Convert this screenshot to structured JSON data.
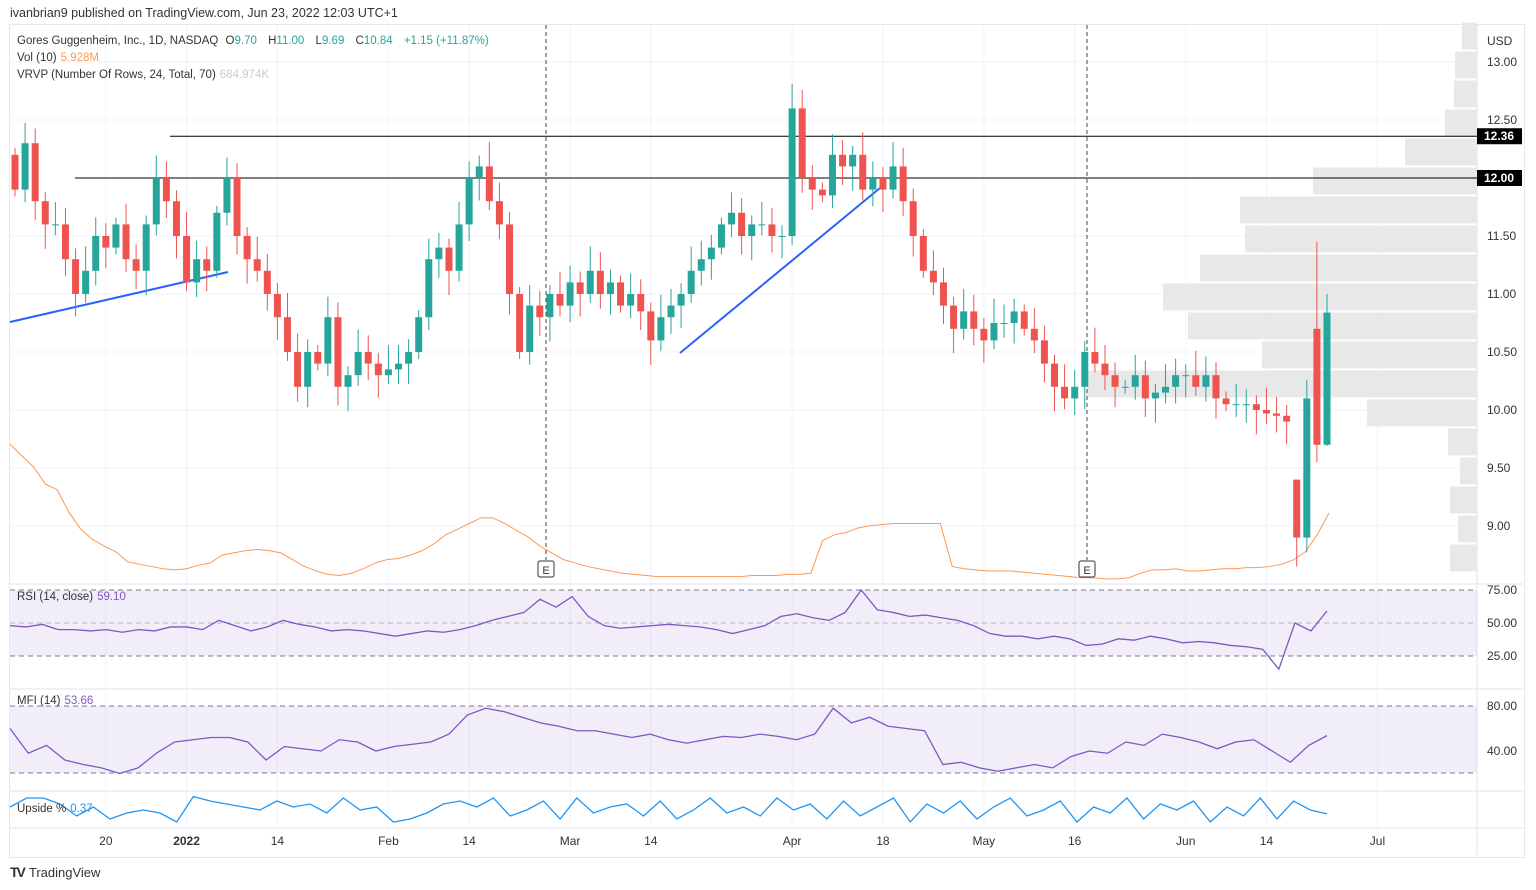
{
  "header": {
    "published": "ivanbrian9 published on TradingView.com, Jun 23, 2022 12:03 UTC+1"
  },
  "legend": {
    "symbol": "Gores Guggenheim, Inc., 1D, NASDAQ",
    "o_label": "O",
    "o": "9.70",
    "h_label": "H",
    "h": "11.00",
    "l_label": "L",
    "l": "9.69",
    "c_label": "C",
    "c": "10.84",
    "change": "+1.15 (+11.87%)",
    "vol_label": "Vol (10)",
    "vol": "5.928M",
    "vrvp_label": "VRVP (Number Of Rows, 24, Total, 70)",
    "vrvp": "684.974K",
    "rsi_label": "RSI (14, close)",
    "rsi": "59.10",
    "mfi_label": "MFI (14)",
    "mfi": "53.66",
    "upside_label": "Upside %",
    "upside": "0.37"
  },
  "footer": {
    "brand": "TradingView"
  },
  "colors": {
    "up": "#26a69a",
    "down": "#ef5350",
    "volume": "#ff9850",
    "osc": "#7e57c2",
    "upside": "#2196f3",
    "trend": "#2962ff"
  },
  "chart_data": {
    "type": "candlestick",
    "currency": "USD",
    "price_ticks": [
      "13.00",
      "12.50",
      "11.50",
      "11.00",
      "10.50",
      "10.00",
      "9.50",
      "9.00"
    ],
    "price_ylim": [
      8.55,
      13.35
    ],
    "level_labels": [
      "12.36",
      "12.00"
    ],
    "levels": [
      12.36,
      12.0
    ],
    "date_ticks": [
      {
        "label": "20",
        "bar": 9
      },
      {
        "label": "2022",
        "bar": 17
      },
      {
        "label": "14",
        "bar": 26
      },
      {
        "label": "Feb",
        "bar": 37
      },
      {
        "label": "14",
        "bar": 45
      },
      {
        "label": "Mar",
        "bar": 55
      },
      {
        "label": "14",
        "bar": 63
      },
      {
        "label": "Apr",
        "bar": 77
      },
      {
        "label": "18",
        "bar": 86
      },
      {
        "label": "May",
        "bar": 96
      },
      {
        "label": "16",
        "bar": 105
      },
      {
        "label": "Jun",
        "bar": 116
      },
      {
        "label": "14",
        "bar": 124
      },
      {
        "label": "Jul",
        "bar": 135
      }
    ],
    "earnings_bars": [
      53,
      105
    ],
    "earnings_label": "E",
    "closes": [
      11.9,
      12.3,
      11.8,
      11.6,
      11.6,
      11.3,
      11.0,
      11.2,
      11.5,
      11.4,
      11.6,
      11.3,
      11.2,
      11.6,
      12.0,
      11.8,
      11.5,
      11.1,
      11.3,
      11.2,
      11.7,
      12.0,
      11.5,
      11.3,
      11.2,
      11.0,
      10.8,
      10.5,
      10.2,
      10.5,
      10.4,
      10.8,
      10.2,
      10.3,
      10.5,
      10.4,
      10.3,
      10.35,
      10.4,
      10.5,
      10.8,
      11.3,
      11.4,
      11.2,
      11.6,
      12.0,
      12.1,
      11.8,
      11.6,
      11.0,
      10.5,
      10.9,
      10.8,
      11.0,
      10.9,
      11.1,
      11.0,
      11.2,
      11.0,
      11.1,
      10.9,
      11.0,
      10.85,
      10.6,
      10.8,
      10.9,
      11.0,
      11.2,
      11.3,
      11.4,
      11.6,
      11.7,
      11.5,
      11.6,
      11.6,
      11.5,
      11.5,
      12.6,
      12.0,
      11.9,
      11.85,
      12.2,
      12.1,
      12.2,
      11.9,
      12.0,
      11.9,
      12.1,
      11.8,
      11.5,
      11.2,
      11.1,
      10.9,
      10.7,
      10.85,
      10.7,
      10.6,
      10.75,
      10.75,
      10.85,
      10.7,
      10.6,
      10.4,
      10.2,
      10.1,
      10.2,
      10.5,
      10.4,
      10.3,
      10.2,
      10.2,
      10.3,
      10.1,
      10.15,
      10.2,
      10.3,
      10.3,
      10.2,
      10.3,
      10.1,
      10.05,
      10.05,
      10.05,
      10.0,
      9.97,
      9.95,
      9.9,
      8.9,
      10.1,
      9.7,
      10.84
    ],
    "last_bar": {
      "open": 9.7,
      "high": 11.0,
      "low": 9.69,
      "close": 10.84
    },
    "volume_ma_millions": [
      12,
      11,
      10,
      8.5,
      8,
      6,
      4.5,
      3.6,
      3,
      2.5,
      1.6,
      1.4,
      1.2,
      1.0,
      0.9,
      1.0,
      1.3,
      1.5,
      2.2,
      2.4,
      2.6,
      2.7,
      2.6,
      2.4,
      1.8,
      1.2,
      0.8,
      0.5,
      0.4,
      0.6,
      1.0,
      1.5,
      1.8,
      1.9,
      2.2,
      2.6,
      3.2,
      4.0,
      4.5,
      5.0,
      5.5,
      5.5,
      5.0,
      4.4,
      3.8,
      3.0,
      2.4,
      1.8,
      1.5,
      1.2,
      1.0,
      0.8,
      0.6,
      0.5,
      0.4,
      0.3,
      0.3,
      0.3,
      0.3,
      0.3,
      0.3,
      0.3,
      0.3,
      0.4,
      0.4,
      0.4,
      0.5,
      0.5,
      0.6,
      3.5,
      4.0,
      4.2,
      4.6,
      4.8,
      4.9,
      5.0,
      5.0,
      5.0,
      5.0,
      5.0,
      1.2,
      1.0,
      0.9,
      0.8,
      0.8,
      0.8,
      0.7,
      0.6,
      0.5,
      0.4,
      0.3,
      0.2,
      0.2,
      0.1,
      0.1,
      0.2,
      0.6,
      0.9,
      0.9,
      1.0,
      0.8,
      0.8,
      0.9,
      1.0,
      1.0,
      1.1,
      1.1,
      1.2,
      1.4,
      1.8,
      2.5,
      4.0,
      5.928
    ],
    "vrvp_rows": [
      {
        "price": 13.1,
        "vol": 15
      },
      {
        "price": 12.85,
        "vol": 22
      },
      {
        "price": 12.6,
        "vol": 23
      },
      {
        "price": 12.35,
        "vol": 32
      },
      {
        "price": 12.1,
        "vol": 72
      },
      {
        "price": 11.85,
        "vol": 164
      },
      {
        "price": 11.6,
        "vol": 237
      },
      {
        "price": 11.35,
        "vol": 232
      },
      {
        "price": 11.1,
        "vol": 277
      },
      {
        "price": 10.85,
        "vol": 314
      },
      {
        "price": 10.6,
        "vol": 289
      },
      {
        "price": 10.35,
        "vol": 215
      },
      {
        "price": 10.1,
        "vol": 390
      },
      {
        "price": 9.85,
        "vol": 110
      },
      {
        "price": 9.6,
        "vol": 29
      },
      {
        "price": 9.35,
        "vol": 17
      },
      {
        "price": 9.1,
        "vol": 27
      },
      {
        "price": 8.85,
        "vol": 19
      },
      {
        "price": 8.6,
        "vol": 27
      }
    ],
    "rsi": {
      "ticks": [
        "75.00",
        "50.00",
        "25.00"
      ],
      "values": [
        48,
        47,
        49,
        45,
        45,
        44,
        45,
        43,
        45,
        44,
        47,
        47,
        45,
        52,
        48,
        44,
        47,
        52,
        49,
        47,
        44,
        45,
        44,
        42,
        40,
        42,
        44,
        43,
        45,
        48,
        52,
        55,
        58,
        68,
        62,
        70,
        55,
        48,
        46,
        47,
        48,
        49,
        48,
        47,
        45,
        42,
        45,
        48,
        55,
        57,
        54,
        52,
        58,
        75,
        60,
        58,
        55,
        56,
        54,
        52,
        48,
        42,
        40,
        40,
        38,
        40,
        38,
        33,
        34,
        38,
        37,
        40,
        38,
        35,
        36,
        35,
        33,
        32,
        30,
        15,
        50,
        44,
        59.1
      ]
    },
    "mfi": {
      "ticks": [
        "80.00",
        "40.00"
      ],
      "values": [
        60,
        38,
        45,
        32,
        28,
        25,
        20,
        25,
        38,
        48,
        50,
        52,
        52,
        48,
        32,
        44,
        42,
        40,
        50,
        48,
        40,
        44,
        46,
        48,
        55,
        72,
        78,
        75,
        70,
        65,
        62,
        58,
        58,
        55,
        52,
        55,
        50,
        47,
        50,
        53,
        52,
        55,
        53,
        50,
        55,
        78,
        65,
        70,
        62,
        60,
        58,
        28,
        30,
        25,
        22,
        25,
        28,
        25,
        35,
        40,
        38,
        48,
        45,
        55,
        52,
        48,
        42,
        48,
        50,
        40,
        30,
        45,
        53.66
      ]
    },
    "upside": {
      "values": [
        0.6,
        0.9,
        0.9,
        0.7,
        0.3,
        0.6,
        0.2,
        0.4,
        0.5,
        0.4,
        0.1,
        0.95,
        0.8,
        0.7,
        0.6,
        0.5,
        0.8,
        0.6,
        0.7,
        0.4,
        0.9,
        0.5,
        0.6,
        0.1,
        0.2,
        0.4,
        0.7,
        0.8,
        0.6,
        0.9,
        0.3,
        0.5,
        0.8,
        0.2,
        0.9,
        0.4,
        0.6,
        0.7,
        0.3,
        0.8,
        0.2,
        0.5,
        0.9,
        0.4,
        0.6,
        0.3,
        0.9,
        0.5,
        0.7,
        0.2,
        0.8,
        0.3,
        0.6,
        0.9,
        0.1,
        0.7,
        0.4,
        0.8,
        0.2,
        0.6,
        0.9,
        0.3,
        0.5,
        0.8,
        0.1,
        0.6,
        0.4,
        0.9,
        0.2,
        0.7,
        0.5,
        0.8,
        0.1,
        0.6,
        0.3,
        0.9,
        0.2,
        0.8,
        0.5,
        0.37
      ]
    }
  }
}
